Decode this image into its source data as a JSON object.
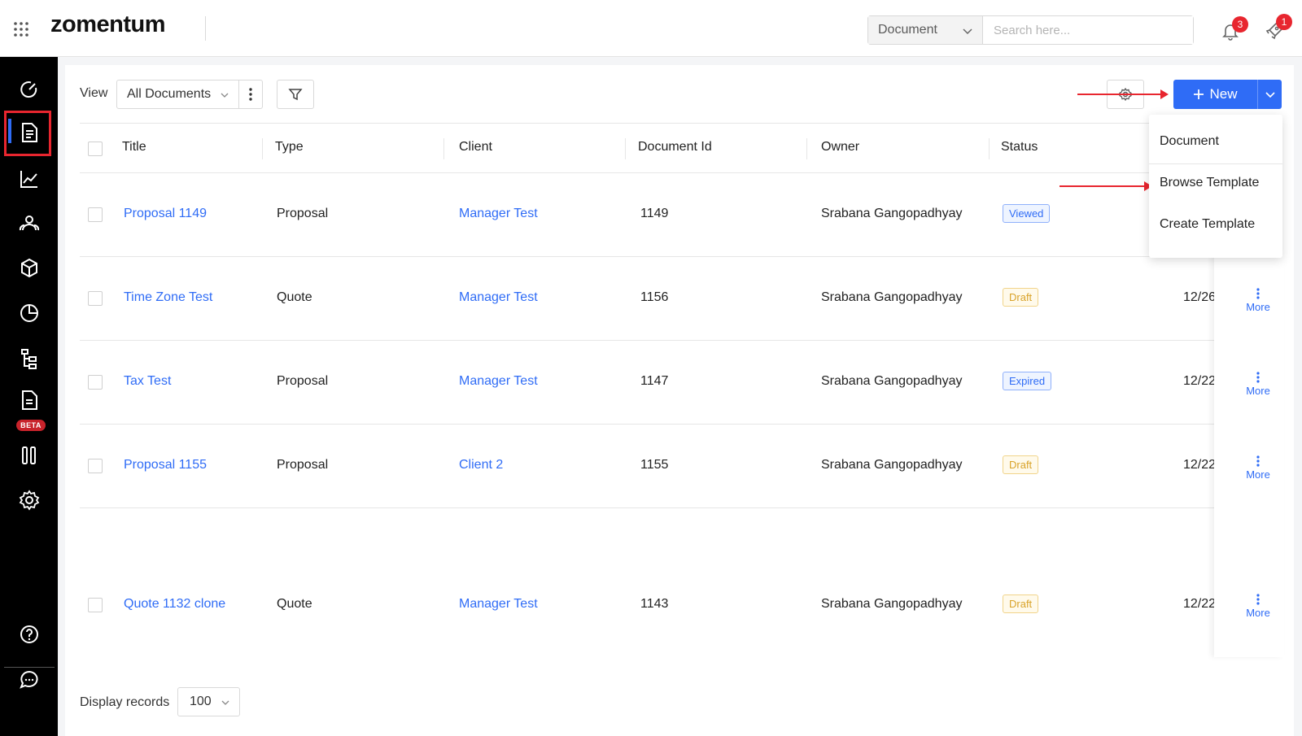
{
  "header": {
    "logo": "zomentum",
    "search_type": "Document",
    "search_placeholder": "Search here...",
    "notifications_count": "3",
    "rocket_count": "1"
  },
  "sidebar": {
    "items": [
      "dashboard-icon",
      "documents-icon",
      "reports-icon",
      "contacts-icon",
      "products-icon",
      "analytics-icon",
      "hierarchy-icon",
      "pdf-icon",
      "board-icon",
      "settings-icon",
      "help-icon",
      "chat-icon"
    ],
    "beta_label": "BETA"
  },
  "toolbar": {
    "view_label": "View",
    "view_value": "All Documents",
    "new_label": "New"
  },
  "new_menu": {
    "items": [
      "Document",
      "Browse Template",
      "Create Template"
    ]
  },
  "table": {
    "headers": [
      "Title",
      "Type",
      "Client",
      "Document Id",
      "Owner",
      "Status"
    ],
    "rows": [
      {
        "title": "Proposal 1149",
        "type": "Proposal",
        "client": "Manager Test",
        "id": "1149",
        "owner": "Srabana Gangopadhyay",
        "status": "Viewed",
        "date": "",
        "more": ""
      },
      {
        "title": "Time Zone Test",
        "type": "Quote",
        "client": "Manager Test",
        "id": "1156",
        "owner": "Srabana Gangopadhyay",
        "status": "Draft",
        "date": "12/26",
        "more": "More"
      },
      {
        "title": "Tax Test",
        "type": "Proposal",
        "client": "Manager Test",
        "id": "1147",
        "owner": "Srabana Gangopadhyay",
        "status": "Expired",
        "date": "12/22",
        "more": "More"
      },
      {
        "title": "Proposal 1155",
        "type": "Proposal",
        "client": "Client 2",
        "id": "1155",
        "owner": "Srabana Gangopadhyay",
        "status": "Draft",
        "date": "12/22",
        "more": "More"
      },
      {
        "title": "Quote 1132 clone",
        "type": "Quote",
        "client": "Manager Test",
        "id": "1143",
        "owner": "Srabana Gangopadhyay",
        "status": "Draft",
        "date": "12/22",
        "more": "More"
      }
    ]
  },
  "footer": {
    "display_label": "Display records",
    "records_value": "100"
  },
  "colors": {
    "accent": "#2f6cf6",
    "annotation": "#e8262f",
    "sidebar_bg": "#000000"
  }
}
